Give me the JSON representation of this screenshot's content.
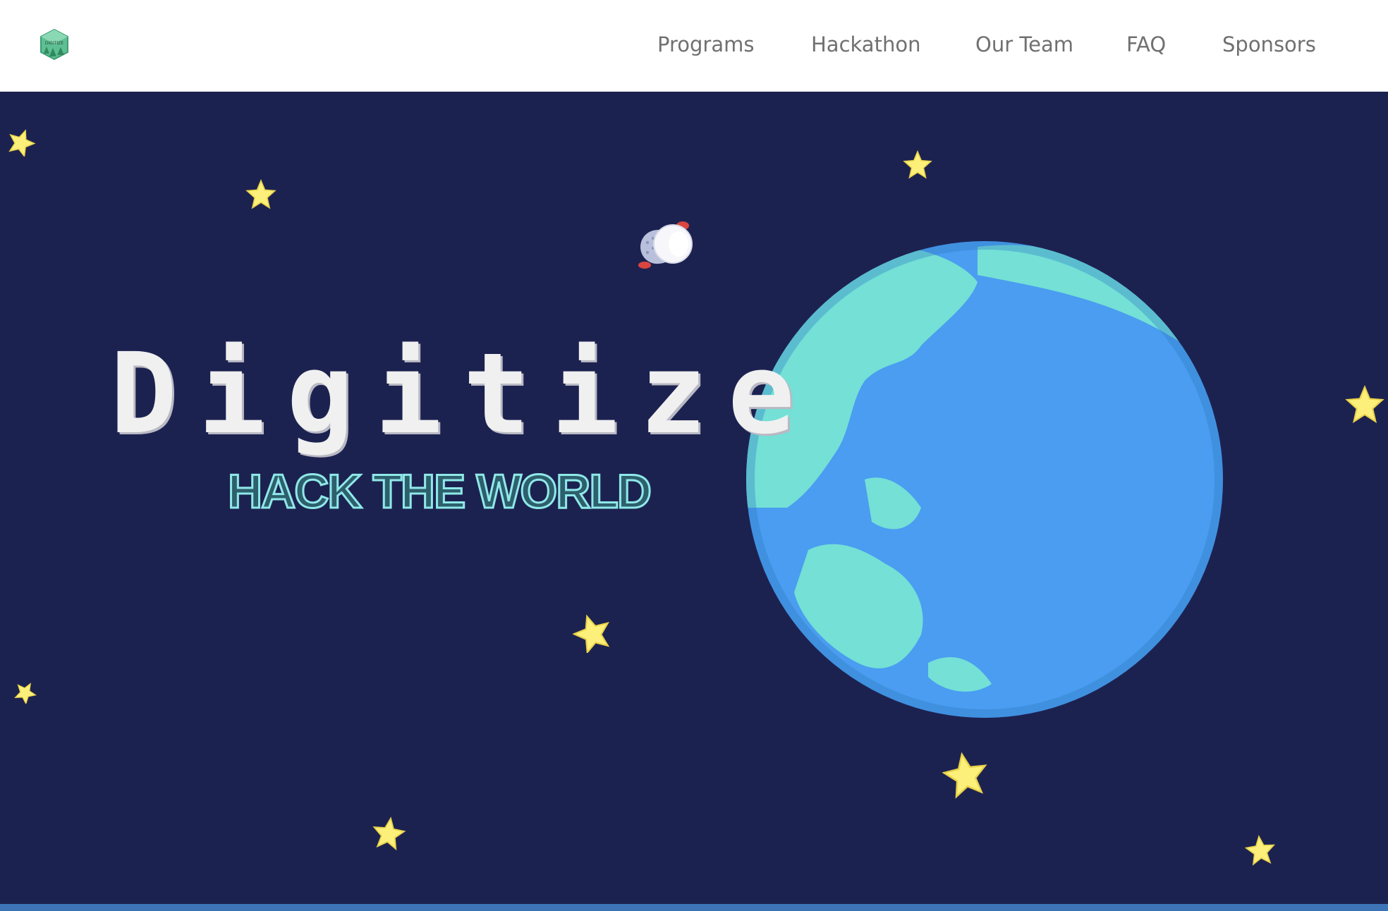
{
  "header": {
    "logo_text": "DIGITIZE",
    "nav": [
      {
        "label": "Programs"
      },
      {
        "label": "Hackathon"
      },
      {
        "label": "Our Team"
      },
      {
        "label": "FAQ"
      },
      {
        "label": "Sponsors"
      }
    ]
  },
  "hero": {
    "title": "Digitize",
    "subtitle": "HACK THE WORLD"
  },
  "colors": {
    "background": "#1c2250",
    "ocean": "#4a9df0",
    "land": "#74e0d6",
    "star": "#fdf07a",
    "nav_text": "#707070",
    "bottom_bar": "#3d74b8"
  },
  "icons": [
    "logo-icon",
    "star-icon",
    "earth-icon",
    "astronaut-icon"
  ]
}
